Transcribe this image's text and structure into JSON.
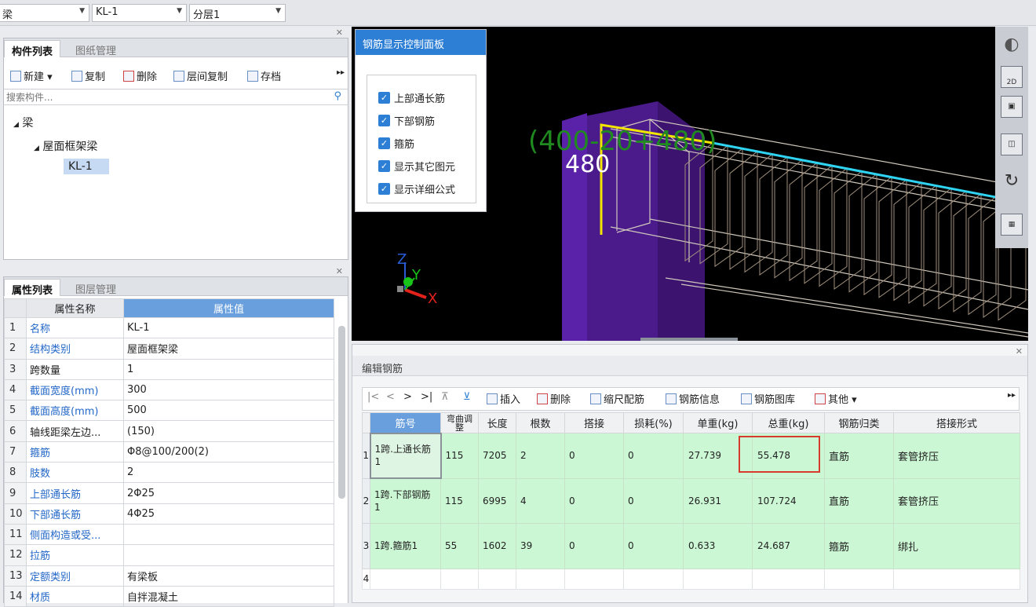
{
  "topbar": {
    "combo1": "梁",
    "combo2": "KL-1",
    "combo3": "分层1"
  },
  "component_panel": {
    "tabs": [
      "构件列表",
      "图纸管理"
    ],
    "toolbar": [
      "新建",
      "复制",
      "删除",
      "层间复制",
      "存档"
    ],
    "search_placeholder": "搜索构件...",
    "tree": {
      "root": "梁",
      "child": "屋面框架梁",
      "leaf": "KL-1"
    }
  },
  "property_panel": {
    "tabs": [
      "属性列表",
      "图层管理"
    ],
    "headers": [
      "属性名称",
      "属性值"
    ],
    "rows": [
      {
        "n": "1",
        "name": "名称",
        "value": "KL-1",
        "blue": true
      },
      {
        "n": "2",
        "name": "结构类别",
        "value": "屋面框架梁",
        "blue": true
      },
      {
        "n": "3",
        "name": "跨数量",
        "value": "1",
        "blue": false
      },
      {
        "n": "4",
        "name": "截面宽度(mm)",
        "value": "300",
        "blue": true
      },
      {
        "n": "5",
        "name": "截面高度(mm)",
        "value": "500",
        "blue": true
      },
      {
        "n": "6",
        "name": "轴线距梁左边...",
        "value": "(150)",
        "blue": false
      },
      {
        "n": "7",
        "name": "箍筋",
        "value": "Φ8@100/200(2)",
        "blue": true
      },
      {
        "n": "8",
        "name": "肢数",
        "value": "2",
        "blue": true
      },
      {
        "n": "9",
        "name": "上部通长筋",
        "value": "2Φ25",
        "blue": true
      },
      {
        "n": "10",
        "name": "下部通长筋",
        "value": "4Φ25",
        "blue": true
      },
      {
        "n": "11",
        "name": "侧面构造或受...",
        "value": "",
        "blue": true
      },
      {
        "n": "12",
        "name": "拉筋",
        "value": "",
        "blue": true
      },
      {
        "n": "13",
        "name": "定额类别",
        "value": "有梁板",
        "blue": true
      },
      {
        "n": "14",
        "name": "材质",
        "value": "自拌混凝土",
        "blue": true
      }
    ]
  },
  "control_panel": {
    "title": "钢筋显示控制面板",
    "items": [
      "上部通长筋",
      "下部钢筋",
      "箍筋",
      "显示其它图元",
      "显示详细公式"
    ]
  },
  "viewport": {
    "formula": "(400-20+480)",
    "dimension": "480",
    "axis": {
      "z": "Z",
      "y": "Y",
      "x": "X"
    },
    "view_badge": "2D"
  },
  "edit_rebar": {
    "title": "编辑钢筋",
    "nav": [
      "|<",
      "<",
      ">",
      ">|"
    ],
    "toolbar": [
      "插入",
      "删除",
      "缩尺配筋",
      "钢筋信息",
      "钢筋图库",
      "其他"
    ],
    "headers": [
      "筋号",
      "弯曲调整",
      "长度",
      "根数",
      "搭接",
      "损耗(%)",
      "单重(kg)",
      "总重(kg)",
      "钢筋归类",
      "搭接形式"
    ],
    "rows": [
      {
        "n": "1",
        "name": "1跨.上通长筋1",
        "bend": "115",
        "length": "7205",
        "count": "2",
        "lap": "0",
        "loss": "0",
        "unit": "27.739",
        "total": "55.478",
        "cat": "直筋",
        "form": "套管挤压"
      },
      {
        "n": "2",
        "name": "1跨.下部钢筋1",
        "bend": "115",
        "length": "6995",
        "count": "4",
        "lap": "0",
        "loss": "0",
        "unit": "26.931",
        "total": "107.724",
        "cat": "直筋",
        "form": "套管挤压"
      },
      {
        "n": "3",
        "name": "1跨.箍筋1",
        "bend": "55",
        "length": "1602",
        "count": "39",
        "lap": "0",
        "loss": "0",
        "unit": "0.633",
        "total": "24.687",
        "cat": "箍筋",
        "form": "绑扎"
      }
    ],
    "empty_row_number": "4"
  }
}
